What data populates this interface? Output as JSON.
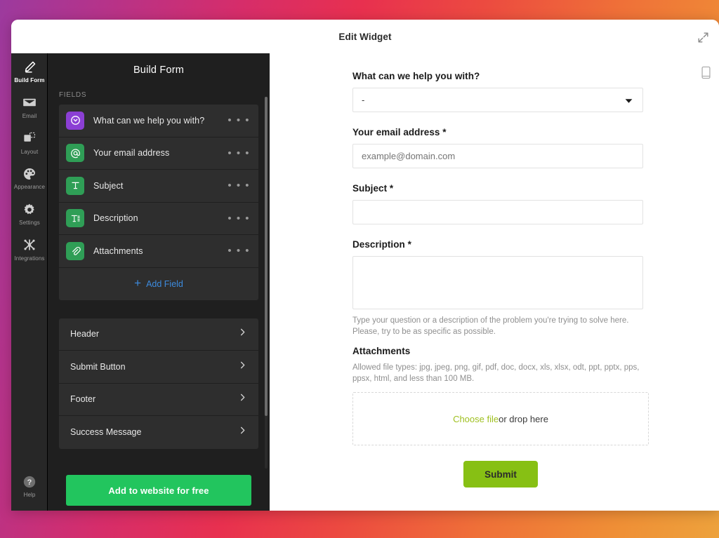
{
  "window": {
    "title": "Edit Widget",
    "expand_icon": "expand-arrows-icon"
  },
  "rail": {
    "items": [
      {
        "label": "Build Form",
        "icon": "pencil-icon",
        "active": true
      },
      {
        "label": "Email",
        "icon": "envelope-icon",
        "active": false
      },
      {
        "label": "Layout",
        "icon": "layout-icon",
        "active": false
      },
      {
        "label": "Appearance",
        "icon": "palette-icon",
        "active": false
      },
      {
        "label": "Settings",
        "icon": "gear-icon",
        "active": false
      },
      {
        "label": "Integrations",
        "icon": "integrations-icon",
        "active": false
      }
    ],
    "help": {
      "label": "Help",
      "icon": "question-circle-icon"
    }
  },
  "panel": {
    "title": "Build Form",
    "fields_caption": "FIELDS",
    "fields": [
      {
        "label": "What can we help you with?",
        "icon": "dropdown-circle-icon",
        "icon_color": "#8b3fd4",
        "menu": "• • •"
      },
      {
        "label": "Your email address",
        "icon": "at-sign-icon",
        "icon_color": "#2f9e56",
        "menu": "• • •"
      },
      {
        "label": "Subject",
        "icon": "text-t-icon",
        "icon_color": "#2f9e56",
        "menu": "• • •"
      },
      {
        "label": "Description",
        "icon": "paragraph-text-icon",
        "icon_color": "#2f9e56",
        "menu": "• • •"
      },
      {
        "label": "Attachments",
        "icon": "paperclip-icon",
        "icon_color": "#2f9e56",
        "menu": "• • •"
      }
    ],
    "add_field_label": "Add Field",
    "add_field_icon": "plus-icon",
    "add_field_color": "#3d8bde",
    "sections": [
      {
        "label": "Header",
        "icon": "chevron-right-icon"
      },
      {
        "label": "Submit Button",
        "icon": "chevron-right-icon"
      },
      {
        "label": "Footer",
        "icon": "chevron-right-icon"
      },
      {
        "label": "Success Message",
        "icon": "chevron-right-icon"
      }
    ],
    "cta_label": "Add to website for free",
    "cta_color": "#22c55e"
  },
  "preview": {
    "device_toggle_icon": "mobile-phone-icon",
    "fields": {
      "help_topic": {
        "label": "What can we help you with?",
        "value": "-",
        "caret_icon": "chevron-down-icon"
      },
      "email": {
        "label": "Your email address *",
        "value": "",
        "placeholder": "example@domain.com"
      },
      "subject": {
        "label": "Subject *",
        "value": "",
        "placeholder": ""
      },
      "description": {
        "label": "Description *",
        "value": "",
        "placeholder": "",
        "help": "Type your question or a description of the problem you're trying to solve here. Please, try to be as specific as possible."
      },
      "attachments": {
        "label": "Attachments",
        "help": "Allowed file types: jpg, jpeg, png, gif, pdf, doc, docx, xls, xlsx, odt, ppt, pptx, pps, ppsx, html, and less than 100 MB.",
        "choose_link": "Choose file",
        "choose_link_color": "#9fc020",
        "drop_text": " or drop here"
      }
    },
    "submit_label": "Submit",
    "submit_color": "#87c014"
  }
}
